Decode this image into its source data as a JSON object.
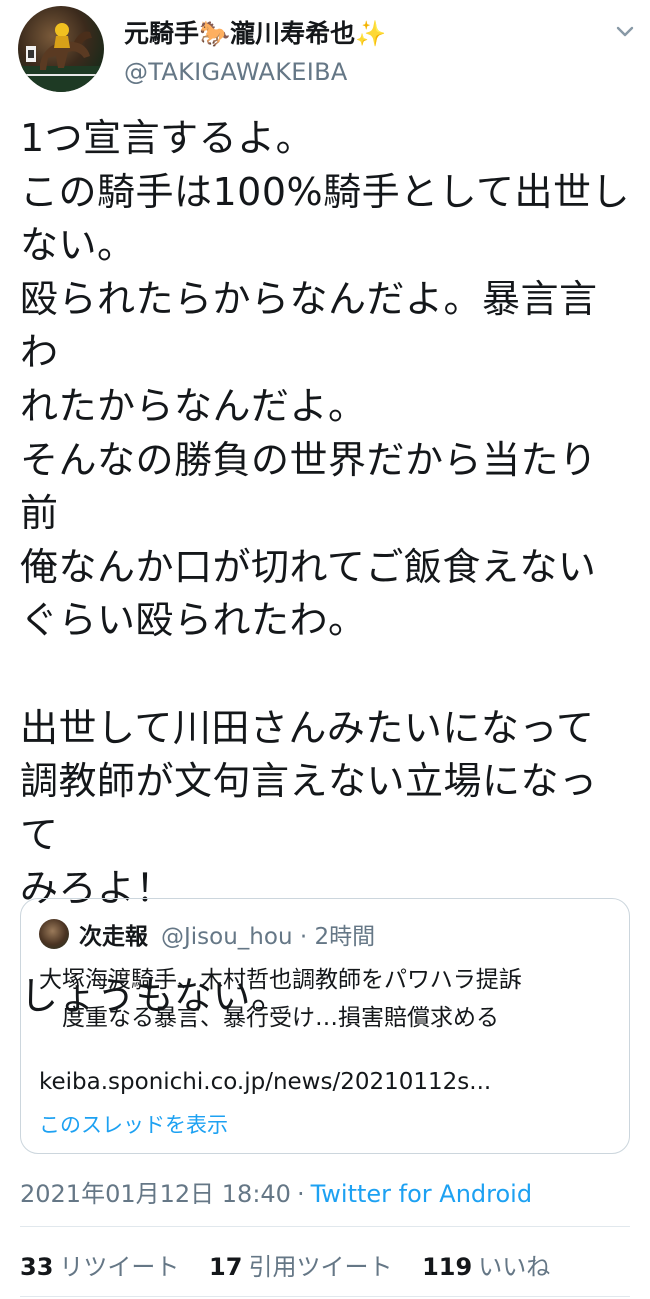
{
  "tweet": {
    "author": {
      "display_name": "元騎手🐎瀧川寿希也✨",
      "handle": "@TAKIGAWAKEIBA"
    },
    "text": "1つ宣言するよ。\nこの騎手は100%騎手として出世し\nない。\n殴られたらからなんだよ。暴言言わ\nれたからなんだよ。\nそんなの勝負の世界だから当たり\n前\n俺なんか口が切れてご飯食えない\nぐらい殴られたわ。\n\n出世して川田さんみたいになって\n調教師が文句言えない立場になって\nみろよ！\n\nしょうもない。",
    "quote": {
      "name": "次走報",
      "handle_time": "@Jisou_hou · 2時間",
      "text": "大塚海渡騎手、木村哲也調教師をパワハラ提訴\n　度重なる暴言、暴行受け…損害賠償求める",
      "link": "keiba.sponichi.co.jp/news/20210112s...",
      "thread_label": "このスレッドを表示"
    },
    "meta": {
      "timestamp": "2021年01月12日 18:40",
      "separator": "·",
      "source": "Twitter for Android"
    },
    "stats": [
      {
        "count": "33",
        "label": "リツイート"
      },
      {
        "count": "17",
        "label": "引用ツイート"
      },
      {
        "count": "119",
        "label": "いいね"
      }
    ]
  },
  "icons": {
    "menu": "chevron-down-icon"
  },
  "colors": {
    "text": "#14171a",
    "secondary": "#657786",
    "accent": "#1da1f2",
    "border": "#ccd6dd"
  }
}
